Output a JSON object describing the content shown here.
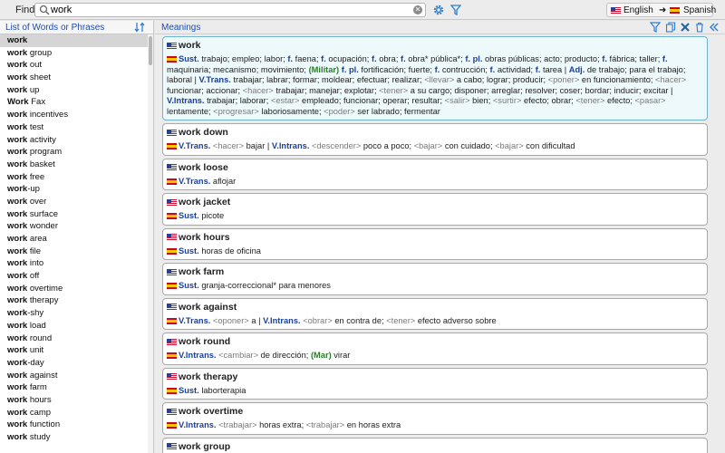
{
  "toolbar": {
    "find_label": "Find:",
    "search_value": "work",
    "source_lang": "English",
    "target_lang": "Spanish"
  },
  "left": {
    "header": "List of Words or Phrases",
    "words": [
      {
        "b": "work",
        "r": ""
      },
      {
        "b": "work",
        "r": " group"
      },
      {
        "b": "work",
        "r": " out"
      },
      {
        "b": "work",
        "r": " sheet"
      },
      {
        "b": "work",
        "r": " up"
      },
      {
        "b": "Work",
        "r": " Fax"
      },
      {
        "b": "work",
        "r": " incentives"
      },
      {
        "b": "work",
        "r": " test"
      },
      {
        "b": "work",
        "r": " activity"
      },
      {
        "b": "work",
        "r": " program"
      },
      {
        "b": "work",
        "r": " basket"
      },
      {
        "b": "work",
        "r": " free"
      },
      {
        "b": "work",
        "r": "-up"
      },
      {
        "b": "work",
        "r": " over"
      },
      {
        "b": "work",
        "r": " surface"
      },
      {
        "b": "work",
        "r": " wonder"
      },
      {
        "b": "work",
        "r": " area"
      },
      {
        "b": "work",
        "r": " file"
      },
      {
        "b": "work",
        "r": " into"
      },
      {
        "b": "work",
        "r": " off"
      },
      {
        "b": "work",
        "r": " overtime"
      },
      {
        "b": "work",
        "r": " therapy"
      },
      {
        "b": "work",
        "r": "-shy"
      },
      {
        "b": "work",
        "r": " load"
      },
      {
        "b": "work",
        "r": " round"
      },
      {
        "b": "work",
        "r": " unit"
      },
      {
        "b": "work",
        "r": "-day"
      },
      {
        "b": "work",
        "r": " against"
      },
      {
        "b": "work",
        "r": " farm"
      },
      {
        "b": "work",
        "r": " hours"
      },
      {
        "b": "work",
        "r": " camp"
      },
      {
        "b": "work",
        "r": " function"
      },
      {
        "b": "work",
        "r": " study"
      }
    ]
  },
  "meanings": {
    "header": "Meanings",
    "entries": [
      {
        "head": "work",
        "parts": [
          {
            "c": "pos",
            "t": "Sust."
          },
          {
            "c": "",
            "t": " trabajo; empleo; labor; "
          },
          {
            "c": "pos",
            "t": "f."
          },
          {
            "c": "",
            "t": " faena; "
          },
          {
            "c": "pos",
            "t": "f."
          },
          {
            "c": "",
            "t": " ocupación; "
          },
          {
            "c": "pos",
            "t": "f."
          },
          {
            "c": "",
            "t": " obra; "
          },
          {
            "c": "pos",
            "t": "f."
          },
          {
            "c": "",
            "t": " obra* pública*; "
          },
          {
            "c": "pos",
            "t": "f. pl."
          },
          {
            "c": "",
            "t": " obras públicas; acto; producto; "
          },
          {
            "c": "pos",
            "t": "f."
          },
          {
            "c": "",
            "t": " fábrica; taller; "
          },
          {
            "c": "pos",
            "t": "f."
          },
          {
            "c": "",
            "t": " maquinaria; mecanismo; movimiento; "
          },
          {
            "c": "reg",
            "t": "(Militar)"
          },
          {
            "c": "",
            "t": " "
          },
          {
            "c": "pos",
            "t": "f. pl."
          },
          {
            "c": "",
            "t": " fortificación; fuerte; "
          },
          {
            "c": "pos",
            "t": "f."
          },
          {
            "c": "",
            "t": " contrucción; "
          },
          {
            "c": "pos",
            "t": "f."
          },
          {
            "c": "",
            "t": " actividad; "
          },
          {
            "c": "pos",
            "t": "f."
          },
          {
            "c": "",
            "t": " tarea | "
          },
          {
            "c": "pos",
            "t": "Adj."
          },
          {
            "c": "",
            "t": " de trabajo; para el trabajo; laboral | "
          },
          {
            "c": "pos",
            "t": "V.Trans."
          },
          {
            "c": "",
            "t": " trabajar; labrar; formar; moldear; efectuar; realizar; "
          },
          {
            "c": "ctx",
            "t": "<llevar>"
          },
          {
            "c": "",
            "t": " a cabo; lograr; producir; "
          },
          {
            "c": "ctx",
            "t": "<poner>"
          },
          {
            "c": "",
            "t": " en funcionamiento; "
          },
          {
            "c": "ctx",
            "t": "<hacer>"
          },
          {
            "c": "",
            "t": " funcionar; accionar; "
          },
          {
            "c": "ctx",
            "t": "<hacer>"
          },
          {
            "c": "",
            "t": " trabajar; manejar; explotar; "
          },
          {
            "c": "ctx",
            "t": "<tener>"
          },
          {
            "c": "",
            "t": " a su cargo; disponer; arreglar; resolver; coser; bordar; inducir; excitar | "
          },
          {
            "c": "pos",
            "t": "V.Intrans."
          },
          {
            "c": "",
            "t": " trabajar; laborar; "
          },
          {
            "c": "ctx",
            "t": "<estar>"
          },
          {
            "c": "",
            "t": " empleado; funcionar; operar; resultar; "
          },
          {
            "c": "ctx",
            "t": "<salir>"
          },
          {
            "c": "",
            "t": " bien; "
          },
          {
            "c": "ctx",
            "t": "<surtir>"
          },
          {
            "c": "",
            "t": " efecto; obrar; "
          },
          {
            "c": "ctx",
            "t": "<tener>"
          },
          {
            "c": "",
            "t": " efecto; "
          },
          {
            "c": "ctx",
            "t": "<pasar>"
          },
          {
            "c": "",
            "t": " lentamente; "
          },
          {
            "c": "ctx",
            "t": "<progresar>"
          },
          {
            "c": "",
            "t": " laboriosamente; "
          },
          {
            "c": "ctx",
            "t": "<poder>"
          },
          {
            "c": "",
            "t": " ser labrado; fermentar"
          }
        ]
      },
      {
        "head": "work down",
        "parts": [
          {
            "c": "pos",
            "t": "V.Trans."
          },
          {
            "c": "",
            "t": " "
          },
          {
            "c": "ctx",
            "t": "<hacer>"
          },
          {
            "c": "",
            "t": " bajar | "
          },
          {
            "c": "pos",
            "t": "V.Intrans."
          },
          {
            "c": "",
            "t": " "
          },
          {
            "c": "ctx",
            "t": "<descender>"
          },
          {
            "c": "",
            "t": " poco a poco; "
          },
          {
            "c": "ctx",
            "t": "<bajar>"
          },
          {
            "c": "",
            "t": " con cuidado; "
          },
          {
            "c": "ctx",
            "t": "<bajar>"
          },
          {
            "c": "",
            "t": " con dificultad"
          }
        ]
      },
      {
        "head": "work loose",
        "parts": [
          {
            "c": "pos",
            "t": "V.Trans."
          },
          {
            "c": "",
            "t": " aflojar"
          }
        ]
      },
      {
        "head": "work jacket",
        "parts": [
          {
            "c": "pos",
            "t": "Sust."
          },
          {
            "c": "",
            "t": " picote"
          }
        ]
      },
      {
        "head": "work hours",
        "parts": [
          {
            "c": "pos",
            "t": "Sust."
          },
          {
            "c": "",
            "t": " horas de oficina"
          }
        ]
      },
      {
        "head": "work farm",
        "parts": [
          {
            "c": "pos",
            "t": "Sust."
          },
          {
            "c": "",
            "t": " granja-correccional* para menores"
          }
        ]
      },
      {
        "head": "work against",
        "parts": [
          {
            "c": "pos",
            "t": "V.Trans."
          },
          {
            "c": "",
            "t": " "
          },
          {
            "c": "ctx",
            "t": "<oponer>"
          },
          {
            "c": "",
            "t": " a | "
          },
          {
            "c": "pos",
            "t": "V.Intrans."
          },
          {
            "c": "",
            "t": " "
          },
          {
            "c": "ctx",
            "t": "<obrar>"
          },
          {
            "c": "",
            "t": " en contra de; "
          },
          {
            "c": "ctx",
            "t": "<tener>"
          },
          {
            "c": "",
            "t": " efecto adverso sobre"
          }
        ]
      },
      {
        "head": "work round",
        "parts": [
          {
            "c": "pos",
            "t": "V.Intrans."
          },
          {
            "c": "",
            "t": " "
          },
          {
            "c": "ctx",
            "t": "<cambiar>"
          },
          {
            "c": "",
            "t": " de dirección; "
          },
          {
            "c": "reg",
            "t": "(Mar)"
          },
          {
            "c": "",
            "t": " virar"
          }
        ]
      },
      {
        "head": "work therapy",
        "parts": [
          {
            "c": "pos",
            "t": "Sust."
          },
          {
            "c": "",
            "t": " laborterapia"
          }
        ]
      },
      {
        "head": "work overtime",
        "parts": [
          {
            "c": "pos",
            "t": "V.Intrans."
          },
          {
            "c": "",
            "t": " "
          },
          {
            "c": "ctx",
            "t": "<trabajar>"
          },
          {
            "c": "",
            "t": " horas extra; "
          },
          {
            "c": "ctx",
            "t": "<trabajar>"
          },
          {
            "c": "",
            "t": " en horas extra"
          }
        ]
      },
      {
        "head": "work group",
        "parts": []
      }
    ]
  },
  "icons": {
    "search": "search-icon",
    "clear": "clear-icon",
    "gear": "gear-icon",
    "filter": "filter-icon",
    "sort": "sort-icon",
    "copy": "copy-icon",
    "delete": "close-icon",
    "trash": "trash-icon",
    "collapse": "double-chevron-left-icon"
  },
  "colors": {
    "accent": "#1b4db5",
    "pos": "#1a3f9e",
    "register": "#2a7a2a",
    "context": "#7a7a7a",
    "first_card_bg": "#eef9fc",
    "first_card_border": "#6fb3cf"
  }
}
